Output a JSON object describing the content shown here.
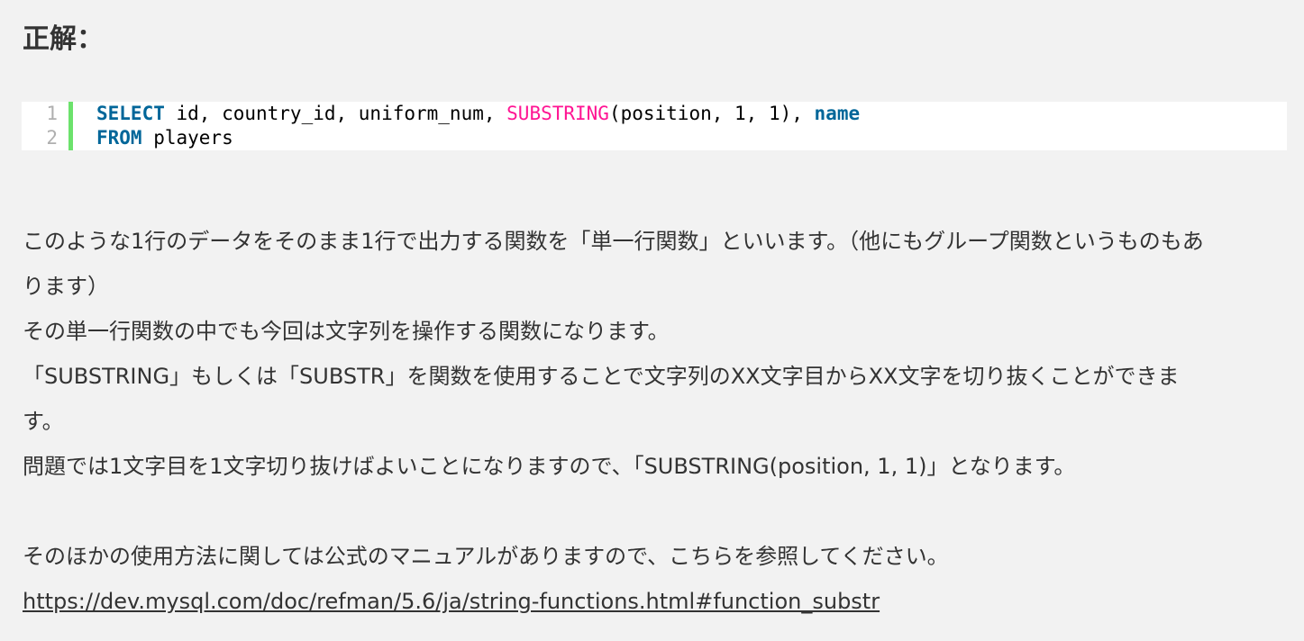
{
  "heading": "正解：",
  "code": {
    "line_numbers": [
      "1",
      "2"
    ],
    "line1": {
      "kw_select": "SELECT",
      "cols": " id, country_id, uniform_num, ",
      "fn_substring": "SUBSTRING",
      "args": "(position, 1, 1), ",
      "kw_name": "name"
    },
    "line2": {
      "kw_from": "FROM",
      "table": " players"
    },
    "accent_color": "#6ce26c",
    "keyword_color": "#006699",
    "function_color": "#ff1493"
  },
  "paragraphs": {
    "p1": "このような1行のデータをそのまま1行で出力する関数を「単一行関数」といいます。（他にもグループ関数というものもありります）",
    "p1_line1": "このような1行のデータをそのまま1行で出力する関数を「単一行関数」といいます。（他にもグループ関数というものもあ",
    "p1_line2": "ります）",
    "p2": "その単一行関数の中でも今回は文字列を操作する関数になります。",
    "p3_line1": "「SUBSTRING」もしくは「SUBSTR」を関数を使用することで文字列のXX文字目からXX文字を切り抜くことができま",
    "p3_line2": "す。",
    "p4": "問題では1文字目を1文字切り抜けばよいことになりますので、「SUBSTRING(position, 1, 1)」となります。",
    "p5": "そのほかの使用方法に関しては公式のマニュアルがありますので、こちらを参照してください。"
  },
  "link": {
    "text": "https://dev.mysql.com/doc/refman/5.6/ja/string-functions.html#function_substr"
  }
}
